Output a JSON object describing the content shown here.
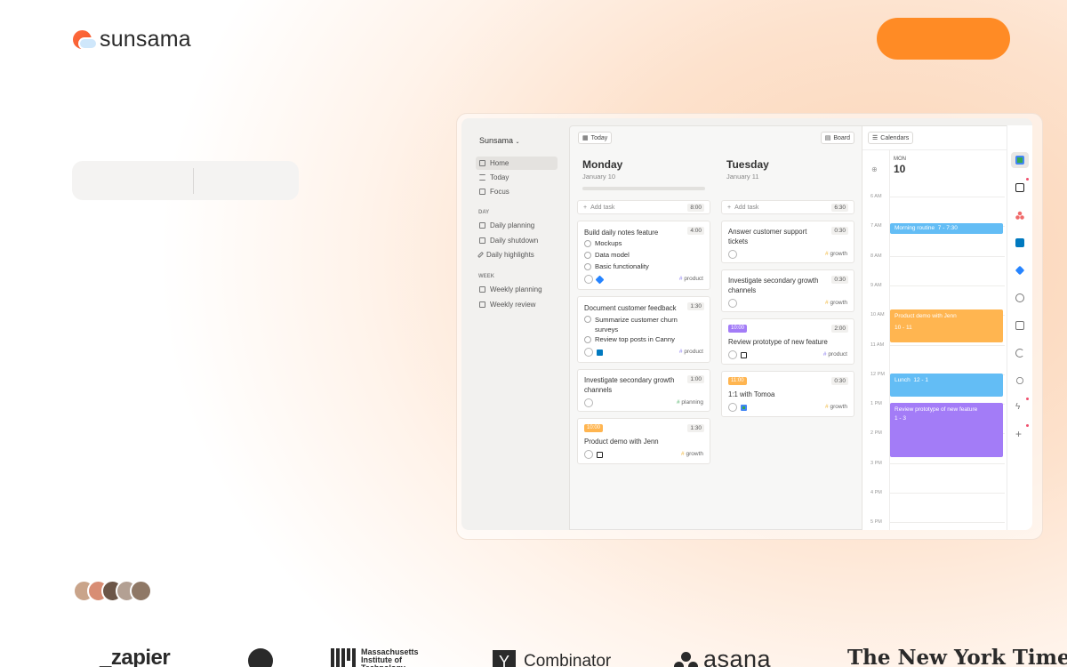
{
  "brand": {
    "name": "sunsama"
  },
  "colors": {
    "accent": "#ff8b25",
    "blue_event": "#63bdf5",
    "orange_event": "#ffb550",
    "purple_event": "#a37cf7"
  },
  "app": {
    "workspace": "Sunsama",
    "nav": [
      {
        "label": "Home",
        "icon": "home-icon"
      },
      {
        "label": "Today",
        "icon": "list-icon"
      },
      {
        "label": "Focus",
        "icon": "monitor-icon"
      }
    ],
    "sections": {
      "day": {
        "label": "DAY",
        "items": [
          {
            "label": "Daily planning"
          },
          {
            "label": "Daily shutdown"
          },
          {
            "label": "Daily highlights"
          }
        ]
      },
      "week": {
        "label": "WEEK",
        "items": [
          {
            "label": "Weekly planning"
          },
          {
            "label": "Weekly review"
          }
        ]
      }
    },
    "toolbar": {
      "today": "Today",
      "board": "Board",
      "calendars": "Calendars"
    },
    "columns": [
      {
        "day": "Monday",
        "date": "January 10",
        "add": "Add task",
        "add_time": "8:00",
        "tasks": [
          {
            "title": "Build daily notes feature",
            "time": "4:00",
            "subtasks": [
              "Mockups",
              "Data model",
              "Basic functionality"
            ],
            "channel": "product"
          },
          {
            "title": "Document customer feedback",
            "time": "1:30",
            "subtasks": [
              "Summarize customer churn surveys",
              "Review top posts in Canny"
            ],
            "channel": "product"
          },
          {
            "title": "Investigate secondary growth channels",
            "time": "1:00",
            "channel": "planning"
          },
          {
            "label": "10:00",
            "title": "Product demo with Jenn",
            "time": "1:30",
            "channel": "growth"
          }
        ]
      },
      {
        "day": "Tuesday",
        "date": "January 11",
        "add": "Add task",
        "add_time": "6:30",
        "tasks": [
          {
            "title": "Answer customer support tickets",
            "time": "0:30",
            "channel": "growth"
          },
          {
            "title": "Investigate secondary growth channels",
            "time": "0:30",
            "channel": "growth"
          },
          {
            "label": "10:00",
            "title": "Review prototype of new feature",
            "time": "2:00",
            "channel": "product"
          },
          {
            "label": "11:00",
            "title": "1:1 with Tomoa",
            "time": "0:30",
            "channel": "growth"
          }
        ]
      }
    ],
    "calendar": {
      "dow": "MON",
      "day": "10",
      "hours": [
        "6 AM",
        "7 AM",
        "8 AM",
        "9 AM",
        "10 AM",
        "11 AM",
        "12 PM",
        "1 PM",
        "2 PM",
        "3 PM",
        "4 PM",
        "5 PM"
      ],
      "events": [
        {
          "title": "Morning routine",
          "time": "7 - 7:30",
          "color": "#63bdf5"
        },
        {
          "title": "Product demo with Jenn",
          "time": "10 - 11",
          "color": "#ffb550"
        },
        {
          "title": "Lunch",
          "time": "12 - 1",
          "color": "#63bdf5"
        },
        {
          "title": "Review prototype of new feature",
          "time": "1 - 3",
          "color": "#a37cf7"
        }
      ]
    },
    "rail_icons": [
      "google-calendar-icon",
      "notion-icon",
      "asana-icon",
      "trello-icon",
      "jira-icon",
      "settings-icon",
      "archive-icon",
      "sync-icon",
      "search-icon",
      "bolt-icon",
      "plus-icon"
    ]
  },
  "logos": {
    "zapier": "_zapier",
    "github": "github-icon",
    "mit": "Massachusetts Institute of Technology",
    "ycombinator_y": "Y",
    "ycombinator": "Combinator",
    "asana": "asana",
    "nyt": "The New York Times"
  }
}
